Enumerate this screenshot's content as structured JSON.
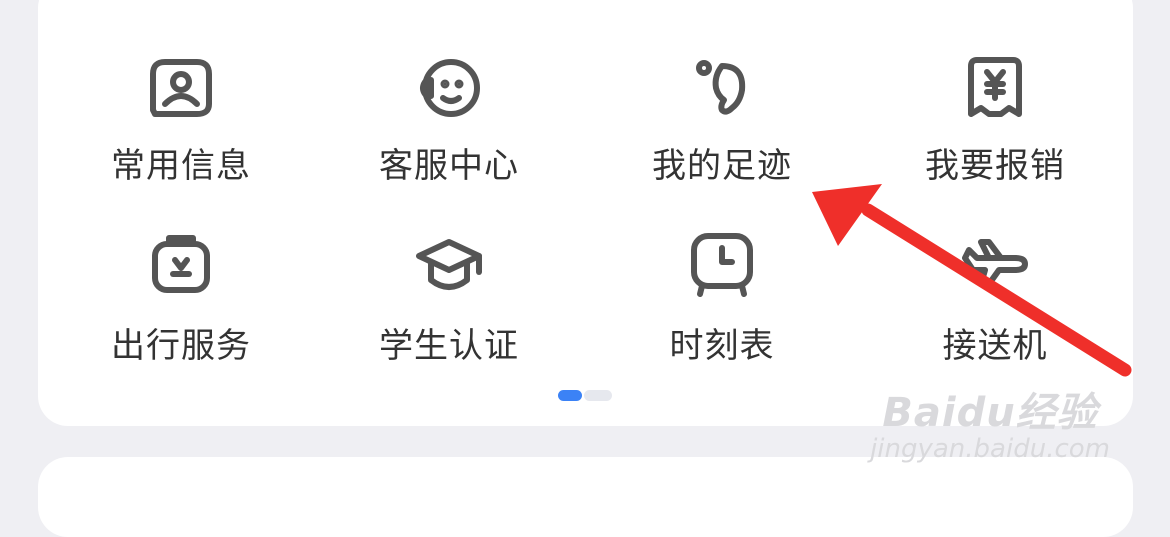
{
  "grid": {
    "row1": [
      {
        "label": "常用信息",
        "icon": "user-card-icon"
      },
      {
        "label": "客服中心",
        "icon": "customer-service-icon"
      },
      {
        "label": "我的足迹",
        "icon": "footprint-icon"
      },
      {
        "label": "我要报销",
        "icon": "reimbursement-icon"
      }
    ],
    "row2": [
      {
        "label": "出行服务",
        "icon": "travel-bag-icon"
      },
      {
        "label": "学生认证",
        "icon": "graduation-cap-icon"
      },
      {
        "label": "时刻表",
        "icon": "clock-icon"
      },
      {
        "label": "接送机",
        "icon": "airplane-icon"
      }
    ]
  },
  "pager": {
    "current_page": 1,
    "total_pages": 2,
    "active_color": "#3b82f6"
  },
  "watermark": {
    "main": "Baidu经验",
    "sub": "jingyan.baidu.com"
  },
  "colors": {
    "icon": "#555555",
    "text": "#333333",
    "arrow": "#ef2f2a",
    "background": "#efeff3",
    "card": "#ffffff"
  }
}
